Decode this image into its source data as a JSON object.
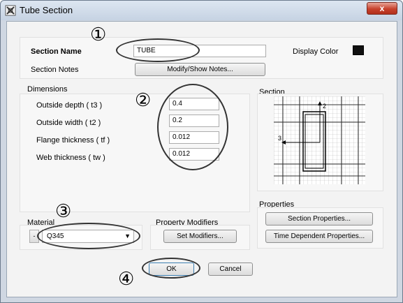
{
  "window": {
    "title": "Tube Section",
    "close_label": "x"
  },
  "section": {
    "name_label": "Section Name",
    "name_value": "TUBE",
    "display_color_label": "Display Color",
    "display_color": "#111111",
    "notes_label": "Section Notes",
    "notes_button": "Modify/Show Notes..."
  },
  "dimensions": {
    "group_label": "Dimensions",
    "fields": [
      {
        "label": "Outside depth  ( t3 )",
        "value": "0.4"
      },
      {
        "label": "Outside width  ( t2 )",
        "value": "0.2"
      },
      {
        "label": "Flange thickness  ( tf )",
        "value": "0.012"
      },
      {
        "label": "Web thickness  ( tw )",
        "value": "0.012"
      }
    ]
  },
  "preview": {
    "group_label": "Section",
    "axis_2": "2",
    "axis_3": "3"
  },
  "properties": {
    "group_label": "Properties",
    "section_button": "Section Properties...",
    "time_button": "Time Dependent Properties..."
  },
  "material": {
    "group_label": "Material",
    "minus_label": "-",
    "selected": "Q345"
  },
  "modifiers": {
    "group_label": "Property Modifiers",
    "button": "Set Modifiers..."
  },
  "actions": {
    "ok": "OK",
    "cancel": "Cancel"
  },
  "annotations": {
    "n1": "①",
    "n2": "②",
    "n3": "③",
    "n4": "④"
  }
}
